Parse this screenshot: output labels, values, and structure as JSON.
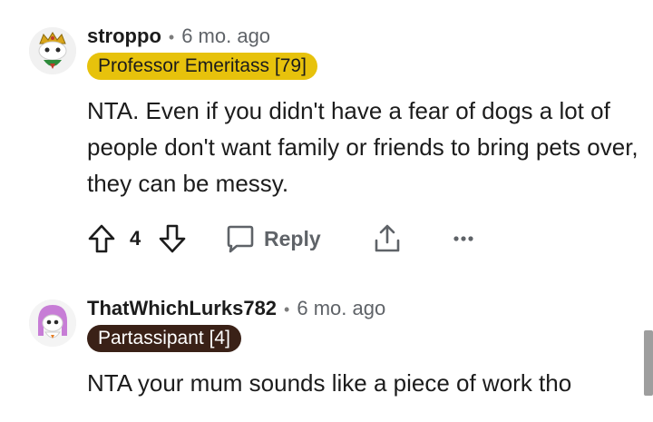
{
  "comments": [
    {
      "username": "stroppo",
      "separator": "•",
      "time": "6 mo. ago",
      "flair": "Professor Emeritass [79]",
      "flair_color": "#e7c20c",
      "text": "NTA. Even if you didn't have a fear of dogs a lot of people don't want family or friends to bring pets over, they can be messy.",
      "vote_count": "4",
      "reply_label": "Reply"
    },
    {
      "username": "ThatWhichLurks782",
      "separator": "•",
      "time": "6 mo. ago",
      "flair": "Partassipant [4]",
      "flair_color": "#3a2117",
      "text": "NTA your mum sounds like a piece of work tho"
    }
  ],
  "icons": {
    "upvote": "arrow-up-outline-icon",
    "downvote": "arrow-down-outline-icon",
    "reply": "speech-bubble-icon",
    "share": "share-upload-icon",
    "more": "ellipsis-icon"
  }
}
